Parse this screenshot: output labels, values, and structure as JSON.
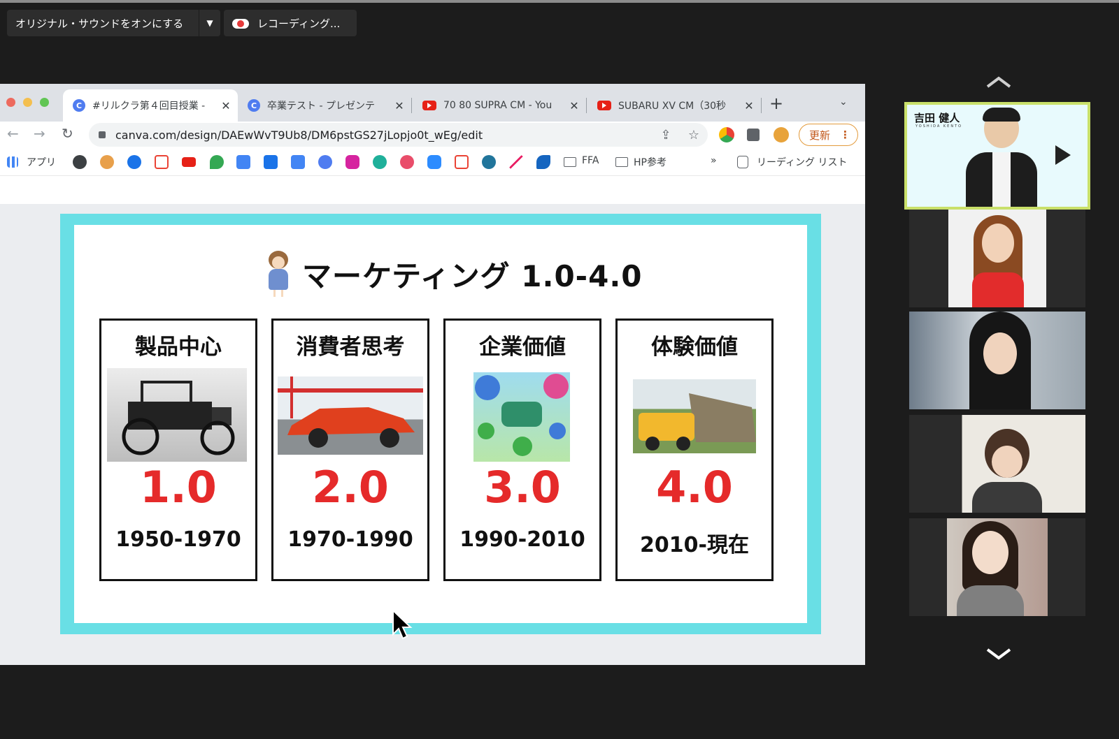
{
  "zoom": {
    "sound_button_label": "オリジナル・サウンドをオンにする",
    "recording_label": "レコーディング..."
  },
  "browser": {
    "tabs": [
      {
        "title": "#リルクラ第４回目授業 -",
        "icon": "canva-icon",
        "active": true
      },
      {
        "title": "卒業テスト - プレゼンテ",
        "icon": "canva-icon",
        "active": false
      },
      {
        "title": "70 80 SUPRA CM - You",
        "icon": "youtube-icon",
        "active": false
      },
      {
        "title": "SUBARU XV CM（30秒",
        "icon": "youtube-icon",
        "active": false
      }
    ],
    "url": "canva.com/design/DAEwWvT9Ub8/DM6pstGS27jLopjo0t_wEg/edit",
    "update_button": "更新",
    "bookmarks": {
      "apps_label": "アプリ",
      "folder1": "FFA",
      "folder2": "HP参考",
      "more": "»",
      "reading_list": "リーディング リスト"
    }
  },
  "slide": {
    "title": "マーケティング 1.0-4.0",
    "cards": [
      {
        "heading": "製品中心",
        "version": "1.0",
        "years": "1950-1970"
      },
      {
        "heading": "消費者思考",
        "version": "2.0",
        "years": "1970-1990"
      },
      {
        "heading": "企業価値",
        "version": "3.0",
        "years": "1990-2010"
      },
      {
        "heading": "体験価値",
        "version": "4.0",
        "years": "2010-現在"
      }
    ]
  },
  "participants": {
    "active_speaker_name": "吉田 健人",
    "active_speaker_romaji": "YOSHIDA KENTO"
  },
  "colors": {
    "slide_border": "#69dfe5",
    "version_red": "#e52a2a",
    "active_speaker_border": "#c9e06a",
    "update_orange": "#e39b3d"
  }
}
